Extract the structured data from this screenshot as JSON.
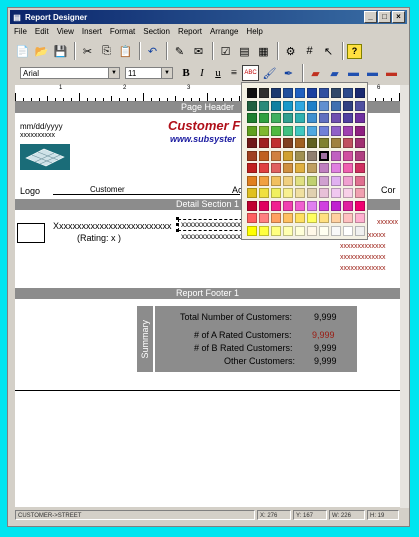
{
  "window": {
    "title": "Report Designer",
    "controls": [
      "_",
      "□",
      "×"
    ]
  },
  "menu": [
    "File",
    "Edit",
    "View",
    "Insert",
    "Format",
    "Section",
    "Report",
    "Arrange",
    "Help"
  ],
  "toolbar_icons": [
    "new-icon",
    "open-icon",
    "save-icon",
    "cut-icon",
    "copy-icon",
    "paste-icon",
    "undo-icon",
    "properties-icon",
    "notes-icon",
    "field-list-icon",
    "preview-icon",
    "print-preview-icon",
    "page-setup-icon",
    "number-icon",
    "cursor-icon",
    "help-icon"
  ],
  "format": {
    "font": "Arial",
    "size": "11",
    "bold": "B",
    "italic": "I",
    "underline": "u"
  },
  "ruler": {
    "labels": [
      "1",
      "2",
      "3",
      "6"
    ]
  },
  "bands": {
    "page_header": "Page Header",
    "detail": "Detail Section 1",
    "report_footer": "Report Footer 1"
  },
  "header": {
    "date": "mm/dd/yyyy",
    "xx": "xxxxxxxxxx",
    "company": "Customer F",
    "website": "www.subsyster",
    "logo": "Logo",
    "customer": "Customer",
    "ac": "Ac",
    "cor": "Cor"
  },
  "detail": {
    "name": "Xxxxxxxxxxxxxxxxxxxxxxxxxx",
    "rating": "(Rating:  x  )",
    "line1": "xxxxxxxxxxxxxxxx",
    "line2": "xxxxxxxxxxxxxxxx",
    "right_col": [
      "xxxxxx",
      "xxxxxxxxxxxxx",
      "xxxxxxxxxxxxx",
      "xxxxxxxxxxxxx",
      "xxxxxxxxxxxxx"
    ]
  },
  "summary": {
    "label": "Summary",
    "rows": [
      {
        "label": "Total Number of Customers:",
        "value": "9,999"
      },
      {
        "label": "# of A Rated Customers:",
        "value": "9,999"
      },
      {
        "label": "# of B Rated Customers:",
        "value": "9,999"
      },
      {
        "label": "Other Customers:",
        "value": "9,999"
      }
    ]
  },
  "status": {
    "field": "CUSTOMER->STREET",
    "x": "X: 276",
    "y": "Y: 167",
    "w": "W: 226",
    "h": "H: 19"
  },
  "palette": {
    "selected": [
      5,
      6
    ],
    "rows": [
      [
        "#101010",
        "#303030",
        "#1c3a70",
        "#204f9c",
        "#2060c0",
        "#1a40a0",
        "#3050a0",
        "#304868",
        "#2c4a8a",
        "#1a2a70"
      ],
      [
        "#206040",
        "#2a8a7a",
        "#1080a0",
        "#1898c8",
        "#30a8e0",
        "#2080c8",
        "#6090d0",
        "#4070b0",
        "#304080",
        "#5050a0"
      ],
      [
        "#208030",
        "#30a040",
        "#40b060",
        "#30a090",
        "#30b0b0",
        "#4090d0",
        "#6070c0",
        "#7050b0",
        "#5040a0",
        "#7030a0"
      ],
      [
        "#60a020",
        "#80b830",
        "#50b840",
        "#40c080",
        "#40c8c0",
        "#50a8e0",
        "#7080d8",
        "#9060c8",
        "#a040b0",
        "#902080"
      ],
      [
        "#701818",
        "#a02020",
        "#c03030",
        "#804020",
        "#a06020",
        "#606020",
        "#808030",
        "#a08040",
        "#c05060",
        "#a03070"
      ],
      [
        "#a04020",
        "#c06020",
        "#d08040",
        "#d0a030",
        "#a09050",
        "#908070",
        "#a070a0",
        "#c060c0",
        "#d050a0",
        "#b04080"
      ],
      [
        "#c02020",
        "#e04040",
        "#e06060",
        "#d09040",
        "#e0b040",
        "#c0a060",
        "#c080c0",
        "#e080e0",
        "#f060b0",
        "#d03060"
      ],
      [
        "#e08020",
        "#f0a040",
        "#f0c060",
        "#f0d080",
        "#e0e080",
        "#c0d070",
        "#d0a0d0",
        "#e0b0f0",
        "#f0a0d0",
        "#e07090"
      ],
      [
        "#e0c020",
        "#f0e040",
        "#f0f060",
        "#f8f090",
        "#f0e0a0",
        "#e0d0b0",
        "#e8c0d8",
        "#f0c8f0",
        "#f8d0e8",
        "#f0a0b0"
      ],
      [
        "#c00030",
        "#e00060",
        "#f02090",
        "#f040b0",
        "#f060d0",
        "#e080f0",
        "#d040e0",
        "#c020d0",
        "#e020a0",
        "#f00070"
      ],
      [
        "#ff6060",
        "#ff8080",
        "#ffa060",
        "#ffc060",
        "#ffe060",
        "#ffff60",
        "#ffe080",
        "#ffd0a0",
        "#ffc0c0",
        "#ffb0d0"
      ],
      [
        "#ffff00",
        "#ffff40",
        "#ffff80",
        "#ffffb0",
        "#ffffd8",
        "#fff8e8",
        "#fffff0",
        "#f8f8f8",
        "#ffffff",
        "#f0f0f0"
      ]
    ]
  }
}
